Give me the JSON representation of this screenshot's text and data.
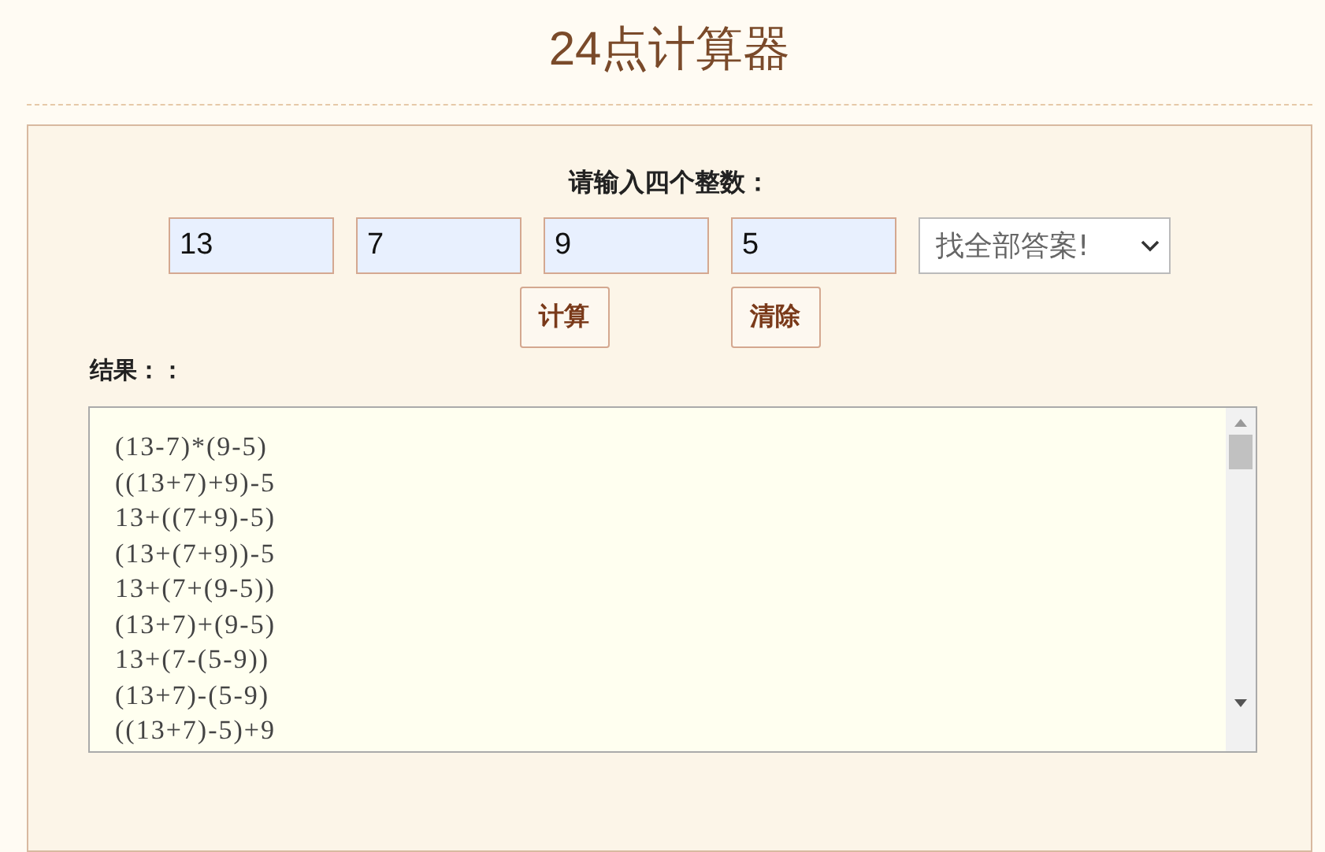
{
  "title": "24点计算器",
  "prompt": "请输入四个整数：",
  "numbers": [
    {
      "value": "13"
    },
    {
      "value": "7"
    },
    {
      "value": "9"
    },
    {
      "value": "5"
    }
  ],
  "mode_select": {
    "value": "找全部答案!"
  },
  "buttons": [
    {
      "label": "计算"
    },
    {
      "label": "清除"
    }
  ],
  "result_label": "结果：：",
  "results": [
    "(13-7)*(9-5)",
    "((13+7)+9)-5",
    "13+((7+9)-5)",
    "(13+(7+9))-5",
    "13+(7+(9-5))",
    "(13+7)+(9-5)",
    "13+(7-(5-9))",
    "(13+7)-(5-9)",
    "((13+7)-5)+9"
  ]
}
